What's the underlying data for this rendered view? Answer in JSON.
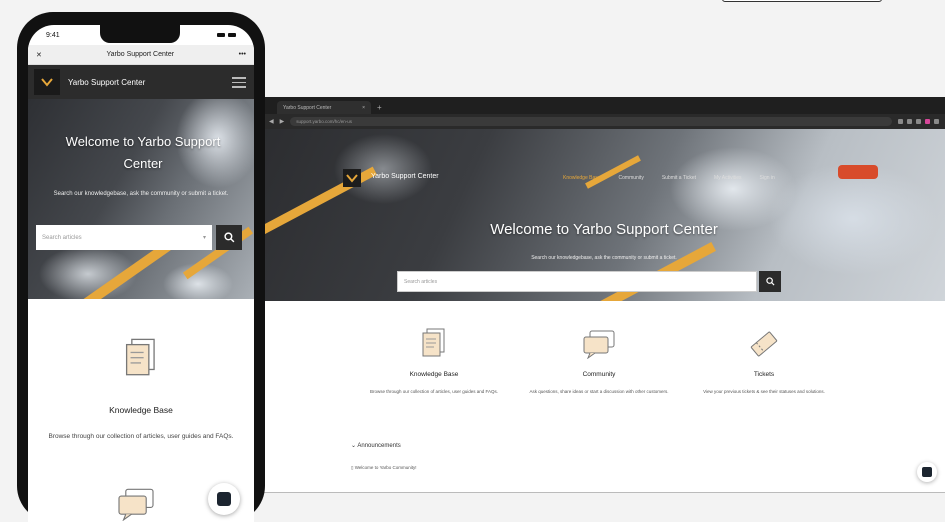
{
  "desktop": {
    "browser_tab_title": "Yarbo Support Center",
    "new_tab_glyph": "+",
    "tab_close_glyph": "×",
    "url": "support.yarbo.com/hc/en-us",
    "site_title": "Yarbo Support Center",
    "nav": [
      "Knowledge Base",
      "Community",
      "Submit a Ticket",
      "My Activities",
      "Sign in"
    ],
    "hero_title": "Welcome to Yarbo Support Center",
    "hero_subtitle": "Search our knowledgebase, ask the community or submit a ticket.",
    "search_placeholder": "Search articles",
    "cards": [
      {
        "icon": "document-icon",
        "title": "Knowledge Base",
        "desc": "Browse through our collection of articles, user guides and FAQs."
      },
      {
        "icon": "chat-icon",
        "title": "Community",
        "desc": "Ask questions, share ideas or start a discussion with other customers."
      },
      {
        "icon": "ticket-icon",
        "title": "Tickets",
        "desc": "View your previous tickets & see their statuses and solutions."
      }
    ],
    "announcements_title": "Announcements",
    "announcement_item": "Welcome to Yarbo Community!"
  },
  "phone": {
    "time": "9:41",
    "page_title": "Yarbo Support Center",
    "close_glyph": "✕",
    "more_glyph": "•••",
    "site_title": "Yarbo Support Center",
    "hero_title": "Welcome to Yarbo Support Center",
    "hero_subtitle": "Search our knowledgebase, ask the community or submit a ticket.",
    "search_placeholder": "Search articles",
    "card_title": "Knowledge Base",
    "card_desc": "Browse through our collection of articles, user guides and FAQs."
  },
  "colors": {
    "accent": "#e6a73a",
    "dark": "#2c2c2c",
    "search_button": "#2b2b2b"
  }
}
